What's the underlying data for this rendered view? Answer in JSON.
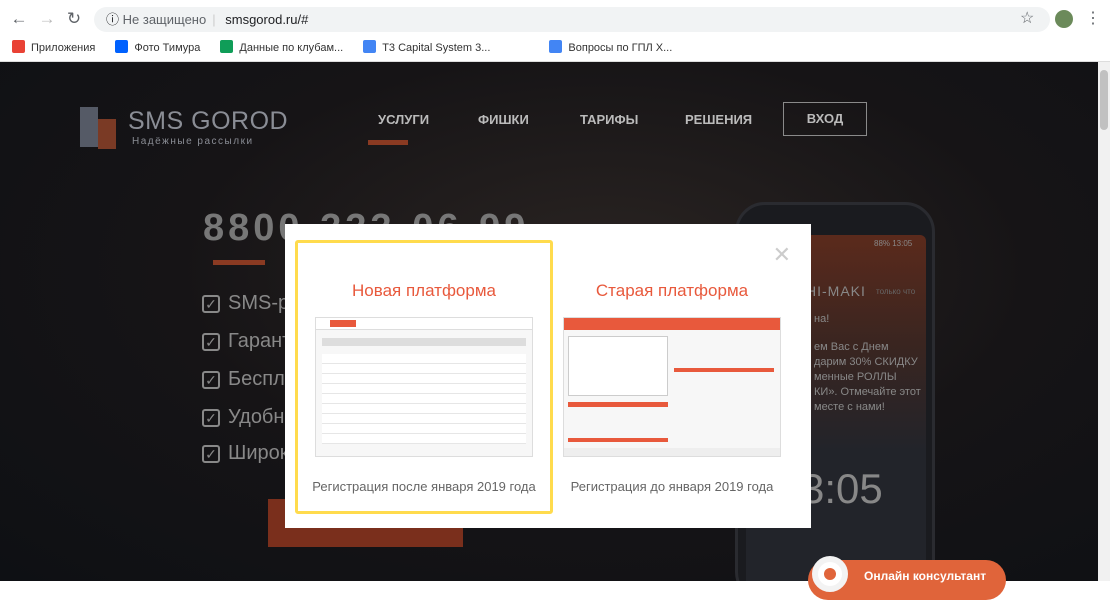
{
  "browser": {
    "security": "Не защищено",
    "url": "smsgorod.ru/#",
    "bookmarks": [
      {
        "label": "Приложения",
        "color": "#e94235"
      },
      {
        "label": "Фото Тимура",
        "color": "#0061fe"
      },
      {
        "label": "Данные по клубам...",
        "color": "#0f9d58"
      },
      {
        "label": "T3 Capital System 3...",
        "color": "#4285f4"
      },
      {
        "label": "",
        "color": "#ffffff"
      },
      {
        "label": "Вопросы по ГПЛ Х...",
        "color": "#4285f4"
      }
    ]
  },
  "site": {
    "logo_title": "SMS GOROD",
    "logo_subtitle": "Надёжные рассылки",
    "nav": [
      "УСЛУГИ",
      "ФИШКИ",
      "ТАРИФЫ",
      "РЕШЕНИЯ"
    ],
    "login": "ВХОД",
    "phone": "8800-333-06-99",
    "features": [
      "SMS-ра",
      "Гарант",
      "Беспла",
      "Удобна",
      "Широк"
    ],
    "device": {
      "status": "88% 13:05",
      "sender": "HI-MAKI",
      "when": "только что",
      "lines": [
        "на!",
        "ем Вас с Днем",
        "дарим 30% СКИДКУ",
        "менные РОЛЛЫ",
        "КИ». Отмечайте этот",
        "месте с нами!"
      ],
      "clock": "3:05"
    },
    "chat": "Онлайн консультант"
  },
  "modal": {
    "options": [
      {
        "title": "Новая платформа",
        "caption": "Регистрация после января 2019 года"
      },
      {
        "title": "Старая платформа",
        "caption": "Регистрация до января 2019 года"
      }
    ]
  }
}
